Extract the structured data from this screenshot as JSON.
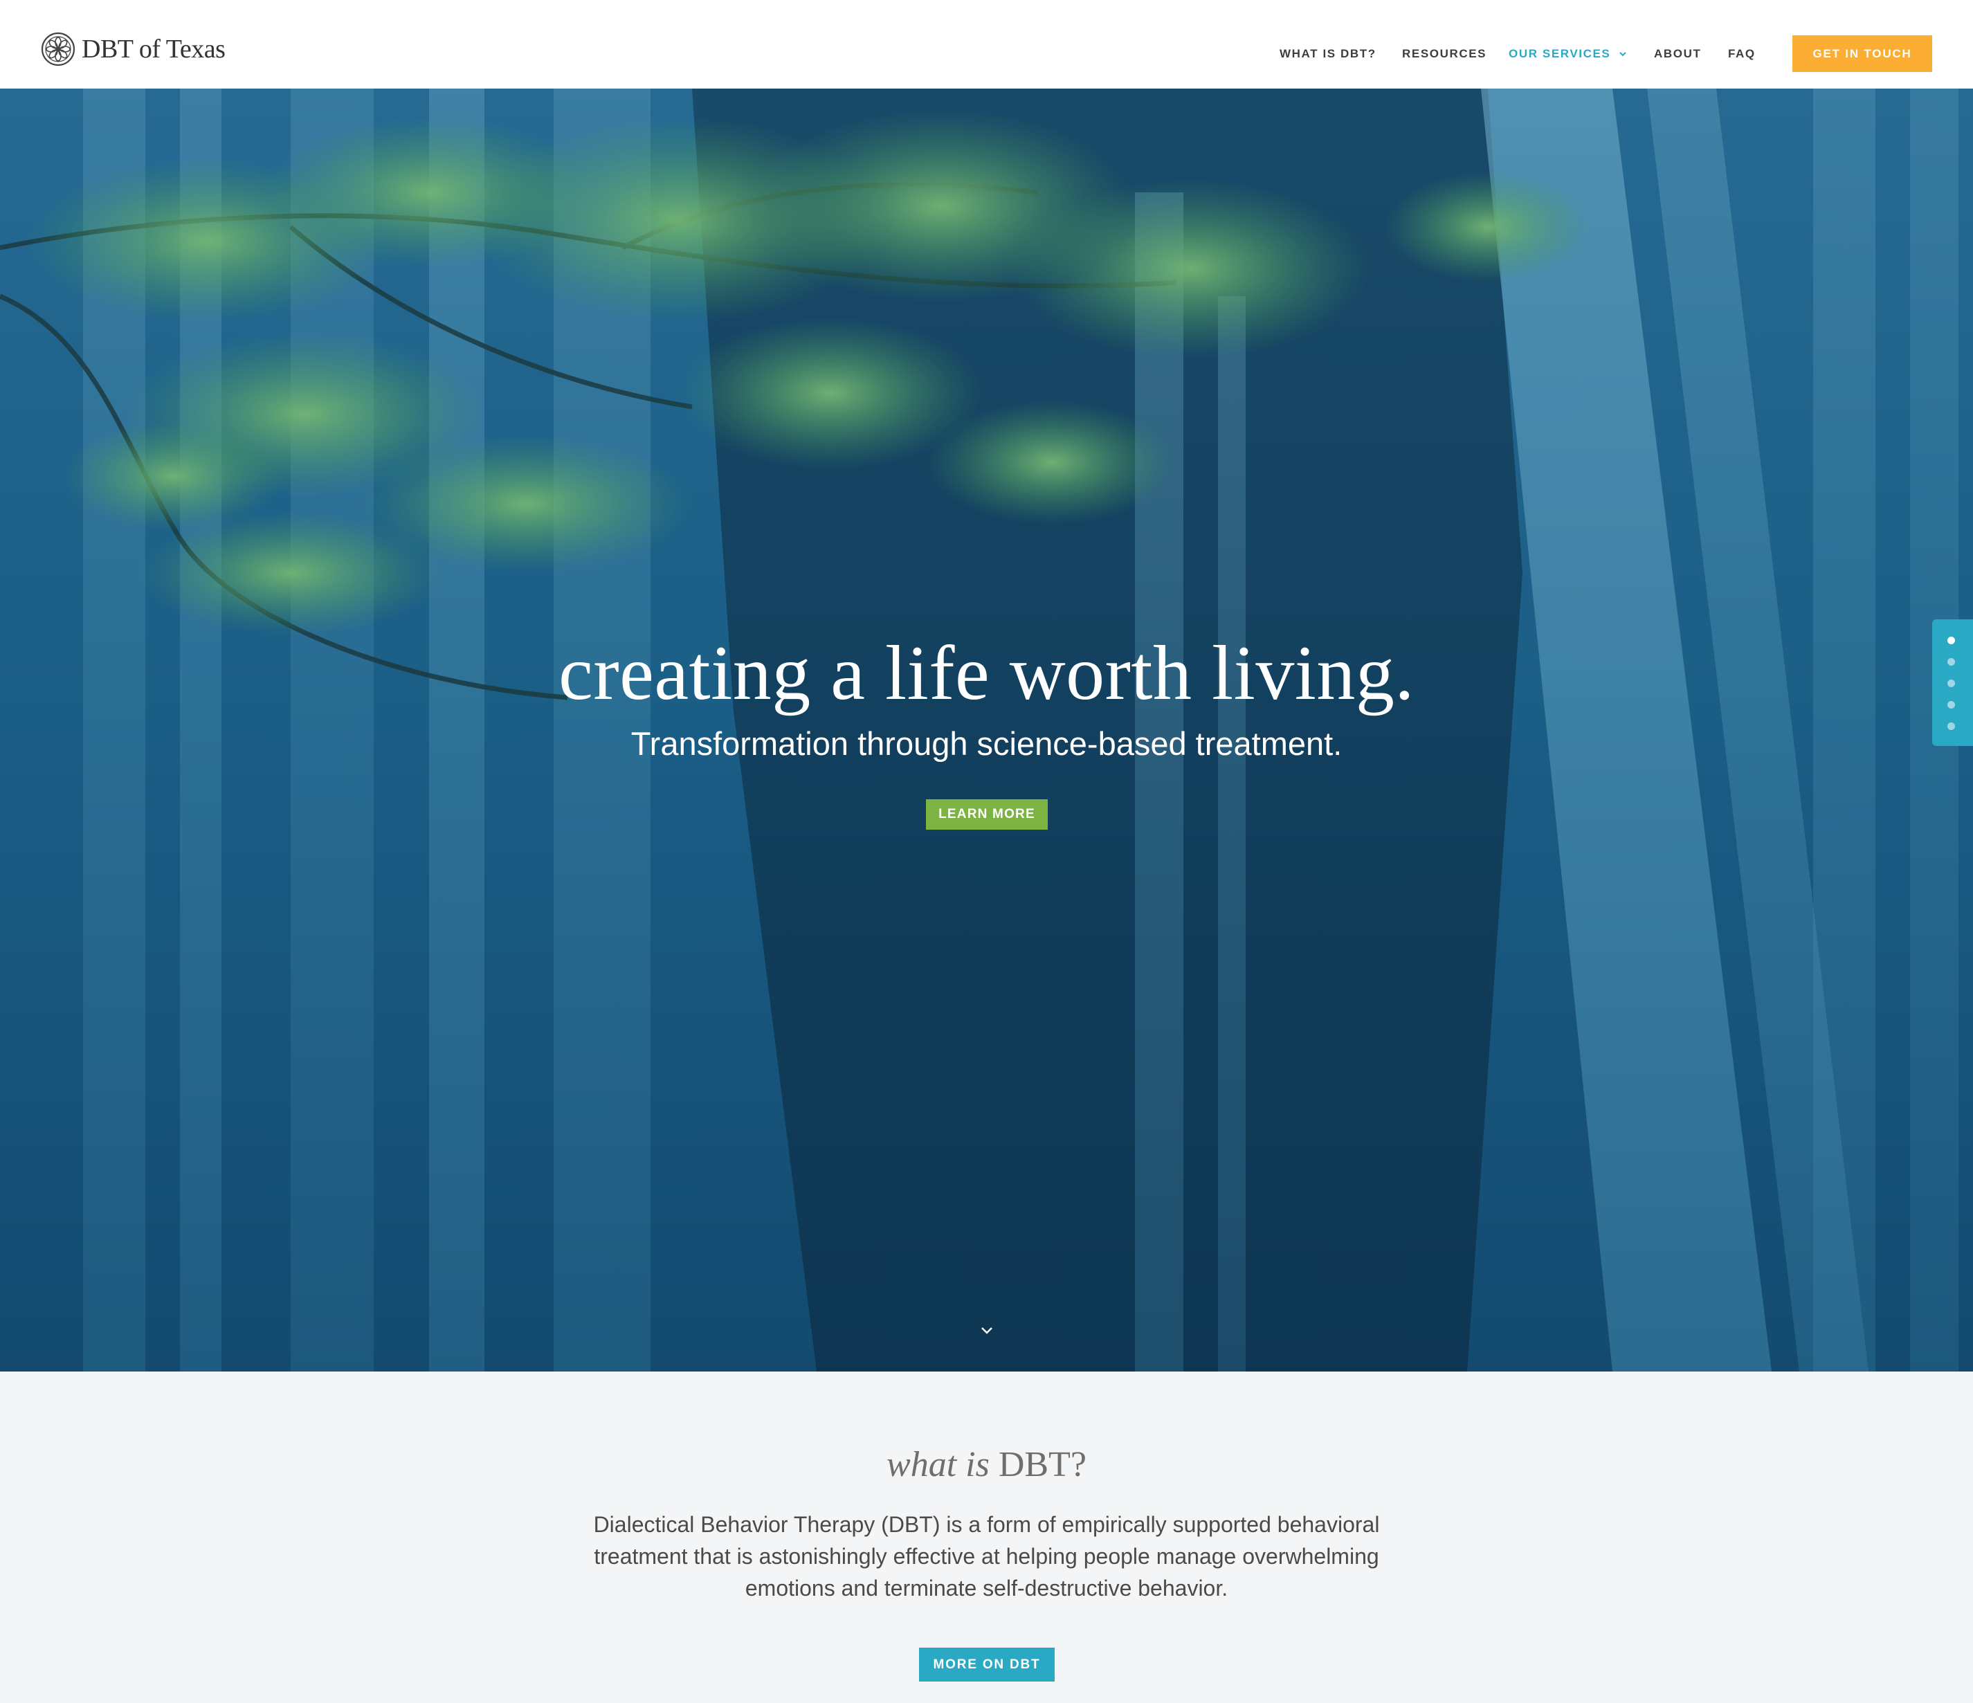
{
  "header": {
    "logo_text": "DBT of Texas",
    "nav": [
      {
        "label": "WHAT IS DBT?"
      },
      {
        "label": "RESOURCES"
      },
      {
        "label": "OUR SERVICES",
        "active": true
      },
      {
        "label": "ABOUT"
      },
      {
        "label": "FAQ"
      }
    ],
    "cta_label": "GET IN TOUCH"
  },
  "hero": {
    "title": "creating a life worth living.",
    "subtitle": "Transformation through science-based treatment.",
    "button_label": "LEARN MORE",
    "scroll_icon": "chevron-down-icon"
  },
  "dot_nav": {
    "count": 5,
    "active_index": 0
  },
  "about": {
    "heading_em": "what is",
    "heading_main": " DBT?",
    "body": "Dialectical Behavior Therapy (DBT) is a form of empirically supported behavioral treatment that is astonishingly effective at helping people manage overwhelming emotions and terminate self-destructive behavior.",
    "button_label": "MORE ON DBT"
  },
  "colors": {
    "accent_teal": "#2aa9c4",
    "cta_orange": "#fbae33",
    "hero_button_green": "#7cb342",
    "section_bg": "#f4f5f7"
  }
}
